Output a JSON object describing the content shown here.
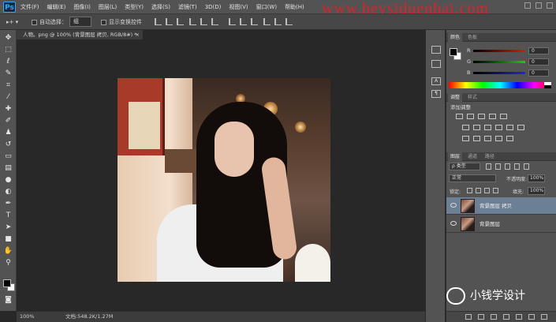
{
  "app": {
    "logo": "Ps",
    "watermark": "www.heysiduenhai.com"
  },
  "menu": [
    "文件(F)",
    "编辑(E)",
    "图像(I)",
    "图层(L)",
    "类型(Y)",
    "选择(S)",
    "滤镜(T)",
    "3D(D)",
    "视图(V)",
    "窗口(W)",
    "帮助(H)"
  ],
  "options": {
    "auto_select_label": "自动选择：",
    "auto_select_value": "组",
    "show_transform_label": "显示变换控件"
  },
  "document": {
    "tab_title": "人物。png @ 100% (背景图层 拷贝, RGB/8#) *",
    "close_glyph": "×"
  },
  "status": {
    "zoom": "100%",
    "doc_info": "文档:548.2K/1.27M"
  },
  "tools": [
    "move-tool",
    "marquee-tool",
    "lasso-tool",
    "quick-select-tool",
    "crop-tool",
    "eyedropper-tool",
    "healing-brush-tool",
    "brush-tool",
    "clone-stamp-tool",
    "history-brush-tool",
    "eraser-tool",
    "gradient-tool",
    "blur-tool",
    "dodge-tool",
    "pen-tool",
    "type-tool",
    "path-select-tool",
    "shape-tool",
    "hand-tool",
    "zoom-tool"
  ],
  "color_panel": {
    "tabs": [
      "颜色",
      "色板"
    ],
    "sliders": [
      {
        "label": "R",
        "value": "0",
        "color": "#d41a1a"
      },
      {
        "label": "G",
        "value": "0",
        "color": "#21c421"
      },
      {
        "label": "B",
        "value": "0",
        "color": "#2424d6"
      }
    ]
  },
  "adjustments_panel": {
    "tabs": [
      "调整",
      "样式"
    ],
    "title": "添加调整"
  },
  "layers_panel": {
    "tabs": [
      "图层",
      "通道",
      "路径"
    ],
    "kind_filter": "ρ 类型",
    "blend_mode": "正常",
    "opacity_label": "不透明度:",
    "opacity_value": "100%",
    "lock_label": "锁定:",
    "fill_label": "填充:",
    "fill_value": "100%",
    "layers": [
      {
        "name": "背景图层 拷贝",
        "selected": true
      },
      {
        "name": "背景图层",
        "selected": false
      }
    ]
  },
  "wechat": {
    "text": "小钱学设计"
  },
  "colors": {
    "accent": "#31a8ff",
    "selected_layer": "#6d7f94",
    "watermark": "#d9232a"
  }
}
